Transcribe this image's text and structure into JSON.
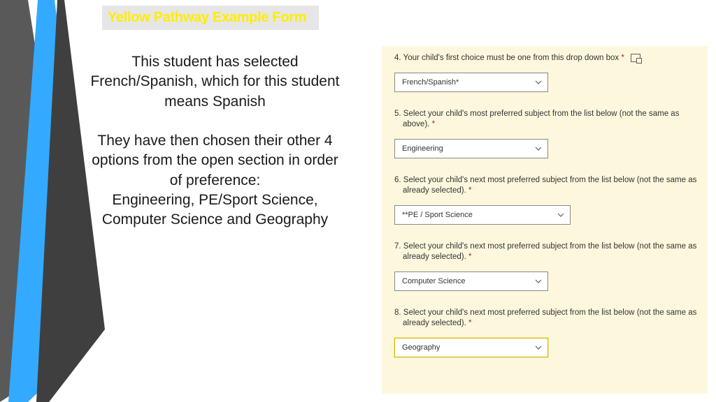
{
  "title": "Yellow Pathway Example Form",
  "body": {
    "p1": "This student has selected French/Spanish, which for this student means Spanish",
    "p2": "They have then chosen their other 4 options from the open section in order of preference:",
    "p3": "Engineering, PE/Sport Science, Computer Science and Geography"
  },
  "required_mark": "*",
  "form": {
    "q4": {
      "num": "4.",
      "text": "Your child's first choice must be one from this drop down box ",
      "value": "French/Spanish*"
    },
    "q5": {
      "num": "5.",
      "text": "Select your child's most preferred subject from the list below (not the same as above). ",
      "value": "Engineering"
    },
    "q6": {
      "num": "6.",
      "text": "Select your child's next most preferred subject from the list below (not the same as already selected). ",
      "value": "**PE / Sport Science"
    },
    "q7": {
      "num": "7.",
      "text": "Select your child's next most preferred subject from the list below (not the same as already selected). ",
      "value": "Computer Science"
    },
    "q8": {
      "num": "8.",
      "text": "Select your child's next most preferred subject from the list below (not the same as already selected). ",
      "value": "Geography"
    }
  }
}
